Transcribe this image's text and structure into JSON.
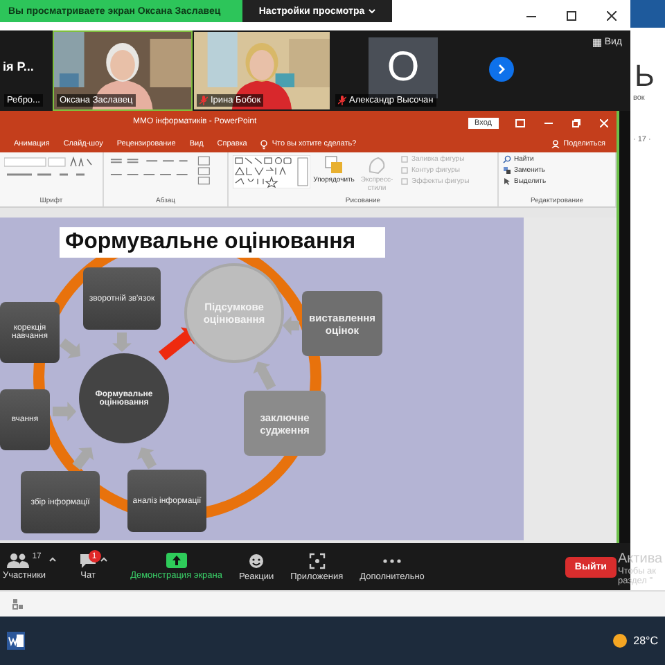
{
  "banner": {
    "text": "Вы просматриваете экран Оксана Заславец",
    "menu": "Настройки просмотра"
  },
  "videos": [
    {
      "kind": "cut",
      "title": "ія Р...",
      "name": "Ребро...",
      "muted": false,
      "selected": false
    },
    {
      "kind": "video",
      "name": "Оксана Заславец",
      "muted": false,
      "selected": true
    },
    {
      "kind": "video",
      "name": "Ірина Бобок",
      "muted": true,
      "selected": false
    },
    {
      "kind": "avatar",
      "initial": "О",
      "name": "Александр Высочан",
      "muted": true,
      "selected": false
    }
  ],
  "view_button": "Вид",
  "powerpoint": {
    "title": "ММО інформатиків - PowerPoint",
    "sign_in": "Вход",
    "tabs": [
      "Анимация",
      "Слайд-шоу",
      "Рецензирование",
      "Вид",
      "Справка"
    ],
    "tell_me": "Что вы хотите сделать?",
    "share": "Поделиться",
    "groups": [
      {
        "kind": "font",
        "label": "Шрифт"
      },
      {
        "kind": "paragraph",
        "label": "Абзац"
      },
      {
        "kind": "drawing",
        "label": "Рисование",
        "buttons": [
          {
            "label": "Упорядочить",
            "disabled": false
          },
          {
            "label": "Экспресс-стили",
            "disabled": true
          }
        ],
        "commands": [
          {
            "label": "Заливка фигуры",
            "disabled": true
          },
          {
            "label": "Контур фигуры",
            "disabled": true
          },
          {
            "label": "Эффекты фигуры",
            "disabled": true
          }
        ]
      },
      {
        "kind": "editing",
        "label": "Редактирование",
        "commands": [
          {
            "label": "Найти",
            "disabled": false
          },
          {
            "label": "Заменить",
            "disabled": false
          },
          {
            "label": "Выделить",
            "disabled": false
          }
        ]
      }
    ],
    "slide": {
      "title": "Формувальне оцінювання",
      "nodes": [
        {
          "kind": "box",
          "text": "зворотній зв'язок"
        },
        {
          "kind": "box",
          "text": "корекція навчання"
        },
        {
          "kind": "box",
          "text": "вчання"
        },
        {
          "kind": "box",
          "text": "збір інформації"
        },
        {
          "kind": "box",
          "text": "аналіз інформації"
        },
        {
          "kind": "hub",
          "text": "Формувальне оцінювання"
        },
        {
          "kind": "goal",
          "text": "Підсумкове оцінювання"
        },
        {
          "kind": "light-box",
          "text": "виставлення оцінок"
        },
        {
          "kind": "lighter-box",
          "text": "заключне судження"
        }
      ]
    }
  },
  "toolbar": [
    {
      "kind": "participants",
      "label": "Участники",
      "count": "17",
      "has_menu": true
    },
    {
      "kind": "chat",
      "label": "Чат",
      "badge": "1",
      "has_menu": true
    },
    {
      "kind": "share",
      "label": "Демонстрация экрана",
      "has_menu": false
    },
    {
      "kind": "reactions",
      "label": "Реакции",
      "has_menu": false
    },
    {
      "kind": "apps",
      "label": "Приложения",
      "has_menu": false
    },
    {
      "kind": "more",
      "label": "Дополнительно",
      "has_menu": false
    }
  ],
  "leave": "Выйти",
  "background_window": {
    "letter": "Ь",
    "tab_text": "вок",
    "ruler": "· 17 ·"
  },
  "activation_notice": [
    "Актива",
    "Чтобы ак",
    "раздел \""
  ],
  "taskbar": {
    "temperature": "28°C"
  }
}
